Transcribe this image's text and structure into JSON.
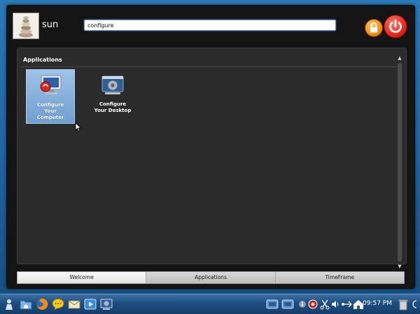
{
  "user": {
    "name": "sun"
  },
  "search": {
    "value": "configure"
  },
  "section": {
    "title": "Applications"
  },
  "results": [
    {
      "label": "Configure\nYour\nComputer",
      "selected": true,
      "icon": "configure-computer-icon"
    },
    {
      "label": "Configure\nYour Desktop",
      "selected": false,
      "icon": "configure-desktop-icon"
    }
  ],
  "tabs": [
    {
      "label": "Welcome",
      "active": true
    },
    {
      "label": "Applications",
      "active": false
    },
    {
      "label": "TimeFrame",
      "active": false
    }
  ],
  "taskbar": {
    "clock": "09:57 PM",
    "launchers": [
      "menu-icon",
      "home-folder-icon",
      "firefox-icon",
      "chat-icon",
      "mail-icon",
      "media-player-icon",
      "configure-icon"
    ],
    "tray": [
      "window-task-icon",
      "window-task-icon",
      "info-icon",
      "settings-tray-icon",
      "scissors-icon",
      "volume-icon",
      "network-icon",
      "home-tray-icon",
      "trash-icon",
      "panel-toggle-icon"
    ]
  },
  "colors": {
    "desktop": "#1f66a3",
    "launcher_bg": "#141414",
    "selected_item": "#8fb4de",
    "power": "#e3261b",
    "lock": "#f08a12"
  }
}
